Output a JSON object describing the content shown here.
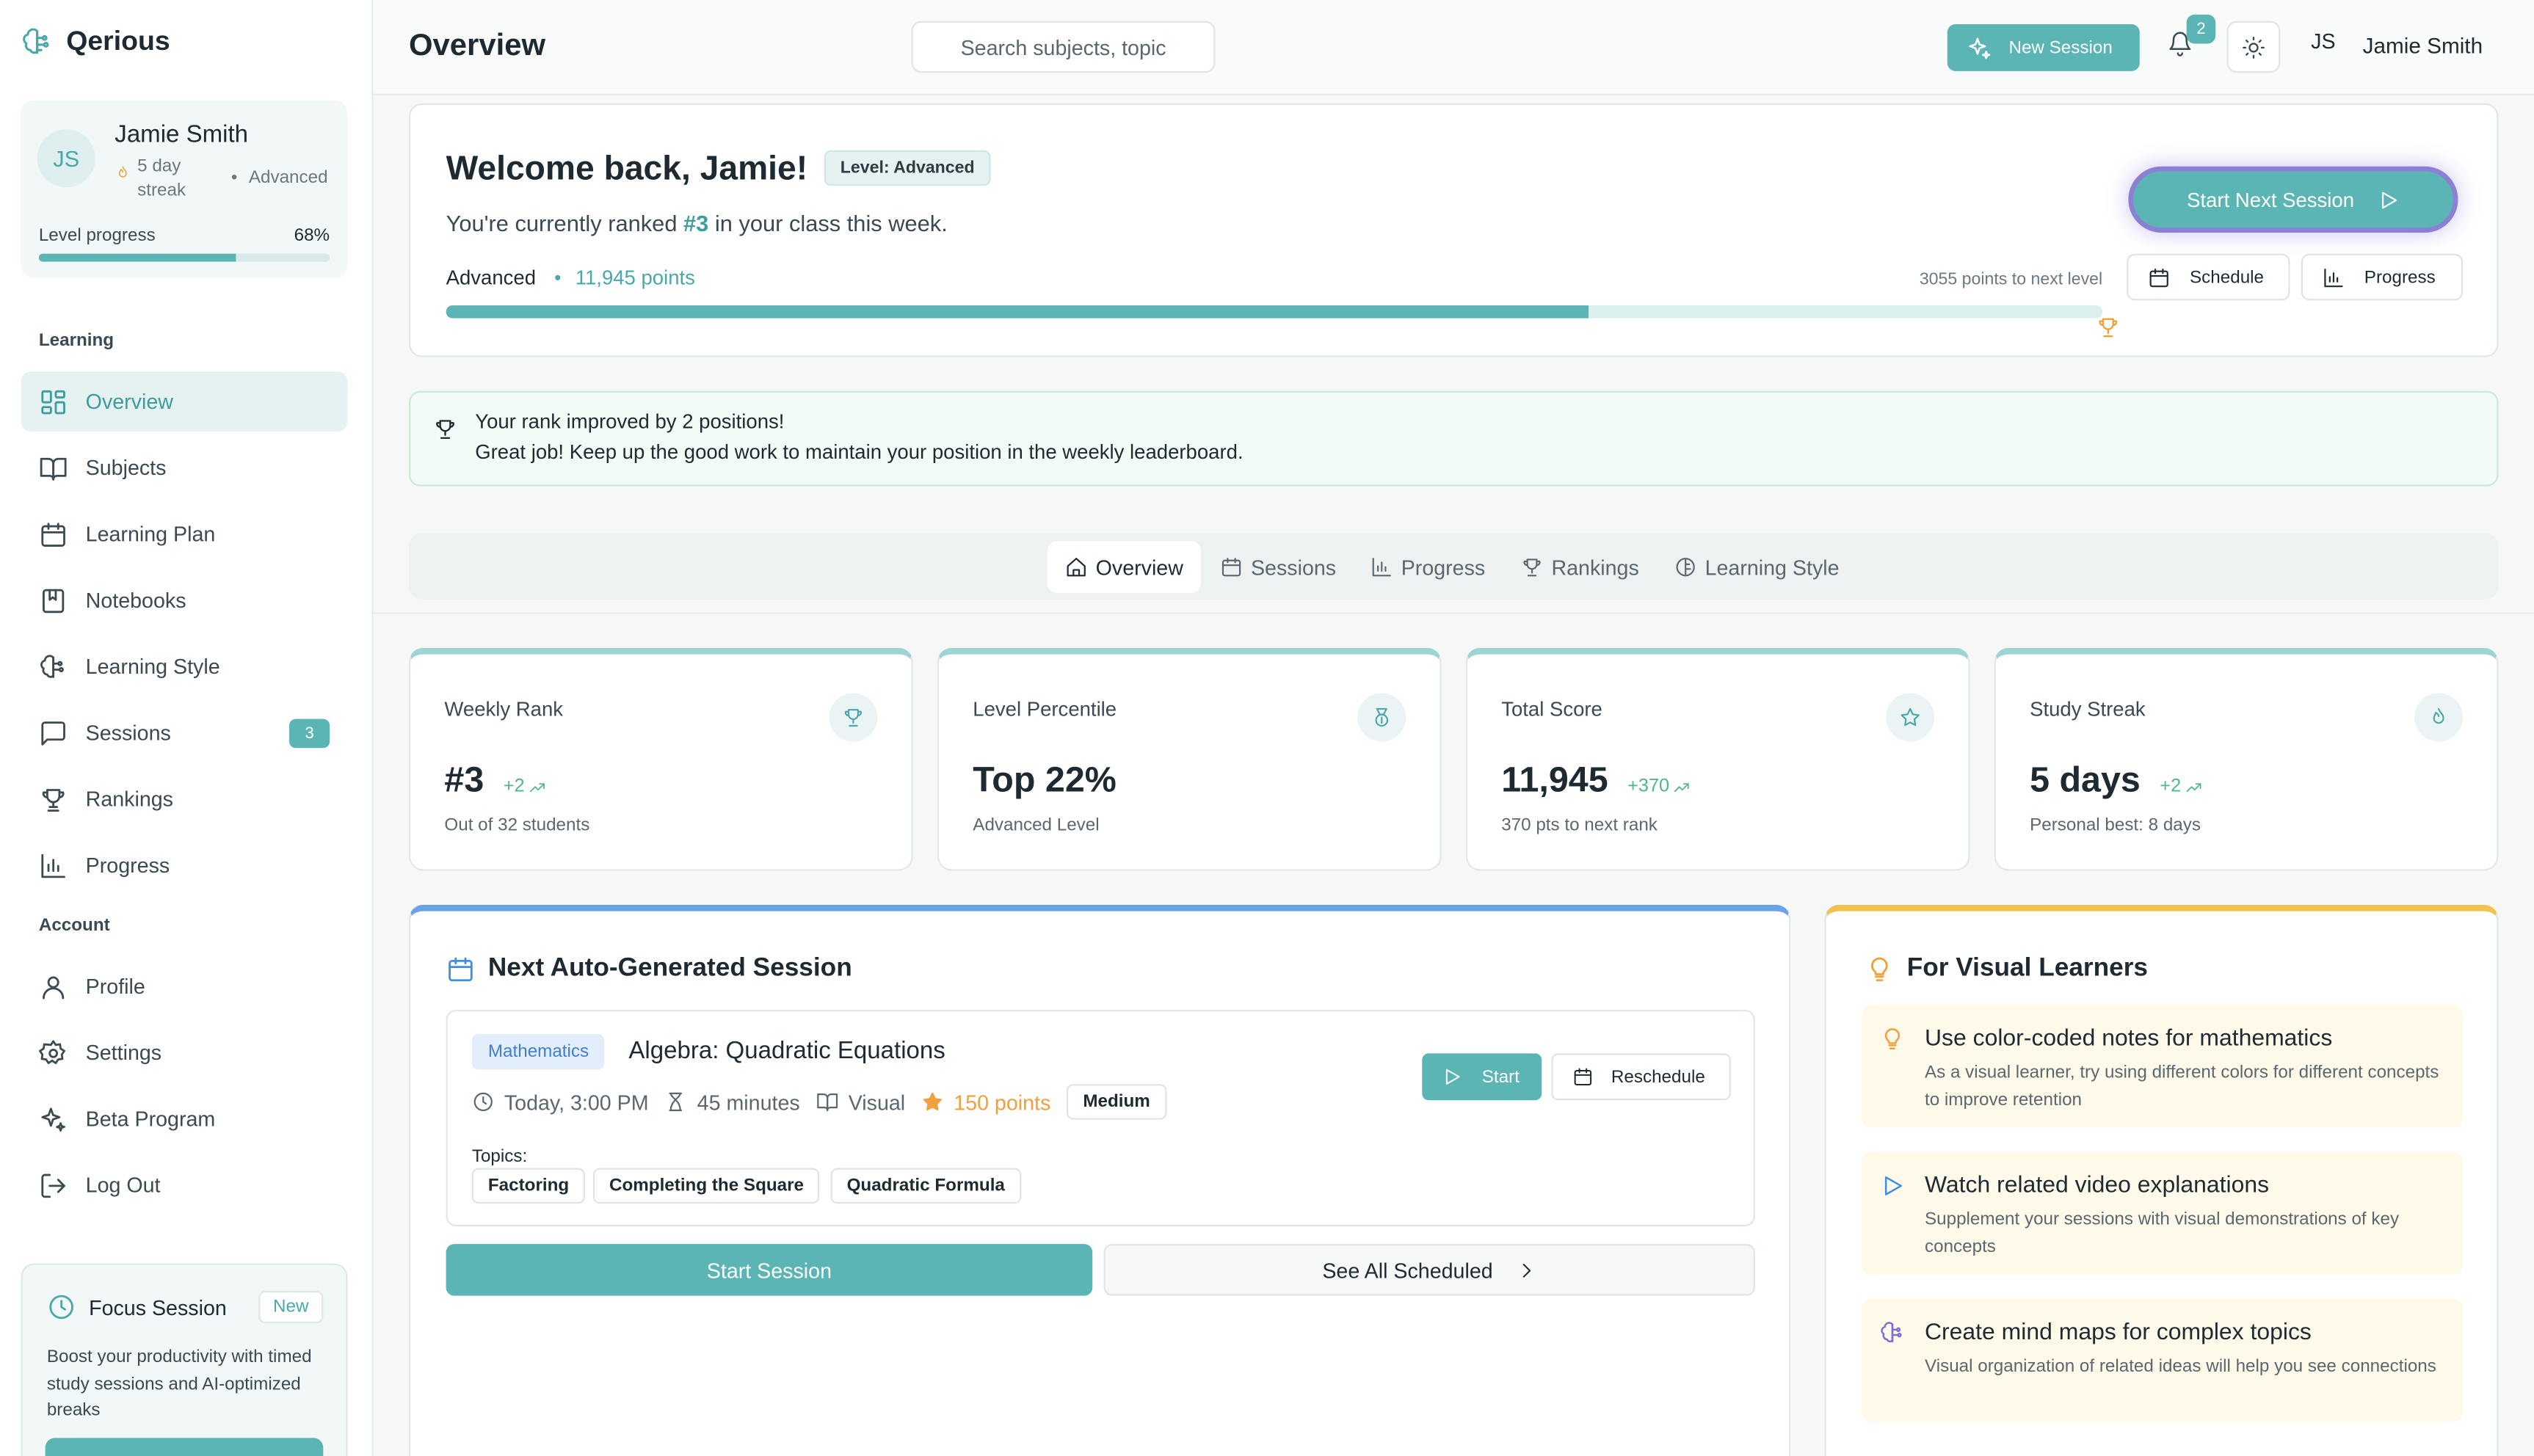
{
  "brand": {
    "name": "Qerious"
  },
  "profile": {
    "initials": "JS",
    "name": "Jamie Smith",
    "streak": "5 day streak",
    "separator": "•",
    "level": "Advanced",
    "progress_label": "Level progress",
    "progress_value": "68%",
    "progress_fraction": 0.68
  },
  "nav": {
    "learning_label": "Learning",
    "learning": [
      {
        "label": "Overview",
        "icon": "layout-grid-icon",
        "active": true
      },
      {
        "label": "Subjects",
        "icon": "book-open-icon"
      },
      {
        "label": "Learning Plan",
        "icon": "calendar-icon"
      },
      {
        "label": "Notebooks",
        "icon": "notebook-icon"
      },
      {
        "label": "Learning Style",
        "icon": "brain-icon"
      },
      {
        "label": "Sessions",
        "icon": "message-icon",
        "badge": "3"
      },
      {
        "label": "Rankings",
        "icon": "trophy-icon"
      },
      {
        "label": "Progress",
        "icon": "bar-chart-icon"
      }
    ],
    "account_label": "Account",
    "account": [
      {
        "label": "Profile",
        "icon": "user-icon"
      },
      {
        "label": "Settings",
        "icon": "gear-icon"
      },
      {
        "label": "Beta Program",
        "icon": "sparkles-icon"
      },
      {
        "label": "Log Out",
        "icon": "logout-icon"
      }
    ]
  },
  "focus": {
    "title": "Focus Session",
    "badge": "New",
    "description": "Boost your productivity with timed study sessions and AI-optimized breaks"
  },
  "header": {
    "title": "Overview",
    "search_placeholder": "Search subjects, topic",
    "new_session": "New Session",
    "notification_count": "2",
    "user_initials": "JS",
    "user_name": "Jamie Smith"
  },
  "welcome": {
    "title": "Welcome back, Jamie!",
    "level_badge": "Level: Advanced",
    "subtitle_pre": "You're currently ranked ",
    "rank": "#3",
    "subtitle_post": " in your class this week.",
    "level": "Advanced",
    "dot": "•",
    "points": "11,945 points",
    "to_next": "3055 points to next level",
    "progress_fraction": 0.69,
    "start_next": "Start Next Session",
    "schedule": "Schedule",
    "progress": "Progress"
  },
  "alert": {
    "title": "Your rank improved by 2 positions!",
    "body": "Great job! Keep up the good work to maintain your position in the weekly leaderboard."
  },
  "tabs": [
    {
      "label": "Overview",
      "icon": "home-icon",
      "active": true
    },
    {
      "label": "Sessions",
      "icon": "calendar-icon"
    },
    {
      "label": "Progress",
      "icon": "bar-chart-icon"
    },
    {
      "label": "Rankings",
      "icon": "trophy-icon"
    },
    {
      "label": "Learning Style",
      "icon": "brain-icon"
    }
  ],
  "stats": [
    {
      "label": "Weekly Rank",
      "value": "#3",
      "delta": "+2",
      "sub": "Out of 32 students",
      "icon": "trophy-icon"
    },
    {
      "label": "Level Percentile",
      "value": "Top 22%",
      "delta": "",
      "sub": "Advanced Level",
      "icon": "medal-icon"
    },
    {
      "label": "Total Score",
      "value": "11,945",
      "delta": "+370",
      "sub": "370 pts to next rank",
      "icon": "star-icon"
    },
    {
      "label": "Study Streak",
      "value": "5 days",
      "delta": "+2",
      "sub": "Personal best: 8 days",
      "icon": "flame-icon"
    }
  ],
  "session": {
    "title": "Next Auto-Generated Session",
    "subject": "Mathematics",
    "name": "Algebra: Quadratic Equations",
    "time": "Today, 3:00 PM",
    "duration": "45 minutes",
    "style": "Visual",
    "points": "150 points",
    "difficulty": "Medium",
    "topics_label": "Topics:",
    "topics": [
      "Factoring",
      "Completing the Square",
      "Quadratic Formula"
    ],
    "start": "Start",
    "reschedule": "Reschedule",
    "start_session": "Start Session",
    "see_all": "See All Scheduled"
  },
  "tips": {
    "title": "For Visual Learners",
    "items": [
      {
        "title": "Use color-coded notes for mathematics",
        "description": "As a visual learner, try using different colors for different concepts to improve retention",
        "icon": "lightbulb-icon",
        "color": "#f0a03c"
      },
      {
        "title": "Watch related video explanations",
        "description": "Supplement your sessions with visual demonstrations of key concepts",
        "icon": "play-icon",
        "color": "#3f8fe0"
      },
      {
        "title": "Create mind maps for complex topics",
        "description": "Visual organization of related ideas will help you see connections",
        "icon": "brain-icon",
        "color": "#7b6fd0"
      }
    ]
  },
  "colors": {
    "accent": "#5ab5b4",
    "accent_dark": "#3c9d9c",
    "gold": "#f0a03c",
    "blue": "#3f8fe0",
    "success": "#4fb883",
    "purple_ring": "#8b7fd6"
  }
}
